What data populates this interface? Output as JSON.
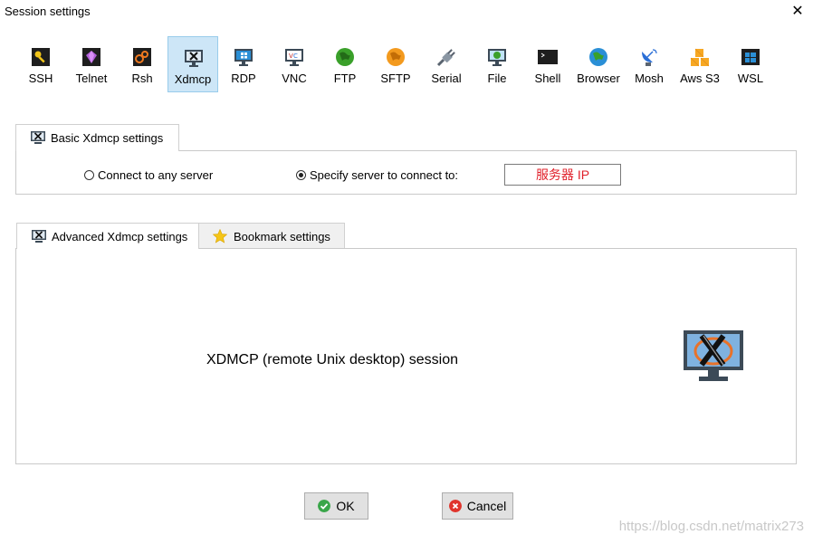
{
  "window": {
    "title": "Session settings",
    "close_glyph": "✕"
  },
  "protocols": [
    {
      "label": "SSH",
      "icon": "key-icon"
    },
    {
      "label": "Telnet",
      "icon": "gem-icon"
    },
    {
      "label": "Rsh",
      "icon": "gears-icon"
    },
    {
      "label": "Xdmcp",
      "icon": "x-monitor-icon",
      "active": true
    },
    {
      "label": "RDP",
      "icon": "windows-monitor-icon"
    },
    {
      "label": "VNC",
      "icon": "vnc-monitor-icon"
    },
    {
      "label": "FTP",
      "icon": "globe-green-icon"
    },
    {
      "label": "SFTP",
      "icon": "globe-orange-icon"
    },
    {
      "label": "Serial",
      "icon": "plug-icon"
    },
    {
      "label": "File",
      "icon": "globe-monitor-icon"
    },
    {
      "label": "Shell",
      "icon": "terminal-icon"
    },
    {
      "label": "Browser",
      "icon": "globe-icon"
    },
    {
      "label": "Mosh",
      "icon": "satellite-dish-icon"
    },
    {
      "label": "Aws S3",
      "icon": "cubes-icon"
    },
    {
      "label": "WSL",
      "icon": "windows-logo-icon"
    }
  ],
  "basic": {
    "tab_label": "Basic Xdmcp settings",
    "radio_any": "Connect to any server",
    "radio_specify": "Specify server to connect to:",
    "server_value": "服务器 IP"
  },
  "advanced": {
    "tab_label": "Advanced Xdmcp settings",
    "bookmark_label": "Bookmark settings",
    "description": "XDMCP (remote Unix desktop) session"
  },
  "buttons": {
    "ok": "OK",
    "cancel": "Cancel"
  },
  "watermark": "https://blog.csdn.net/matrix273"
}
